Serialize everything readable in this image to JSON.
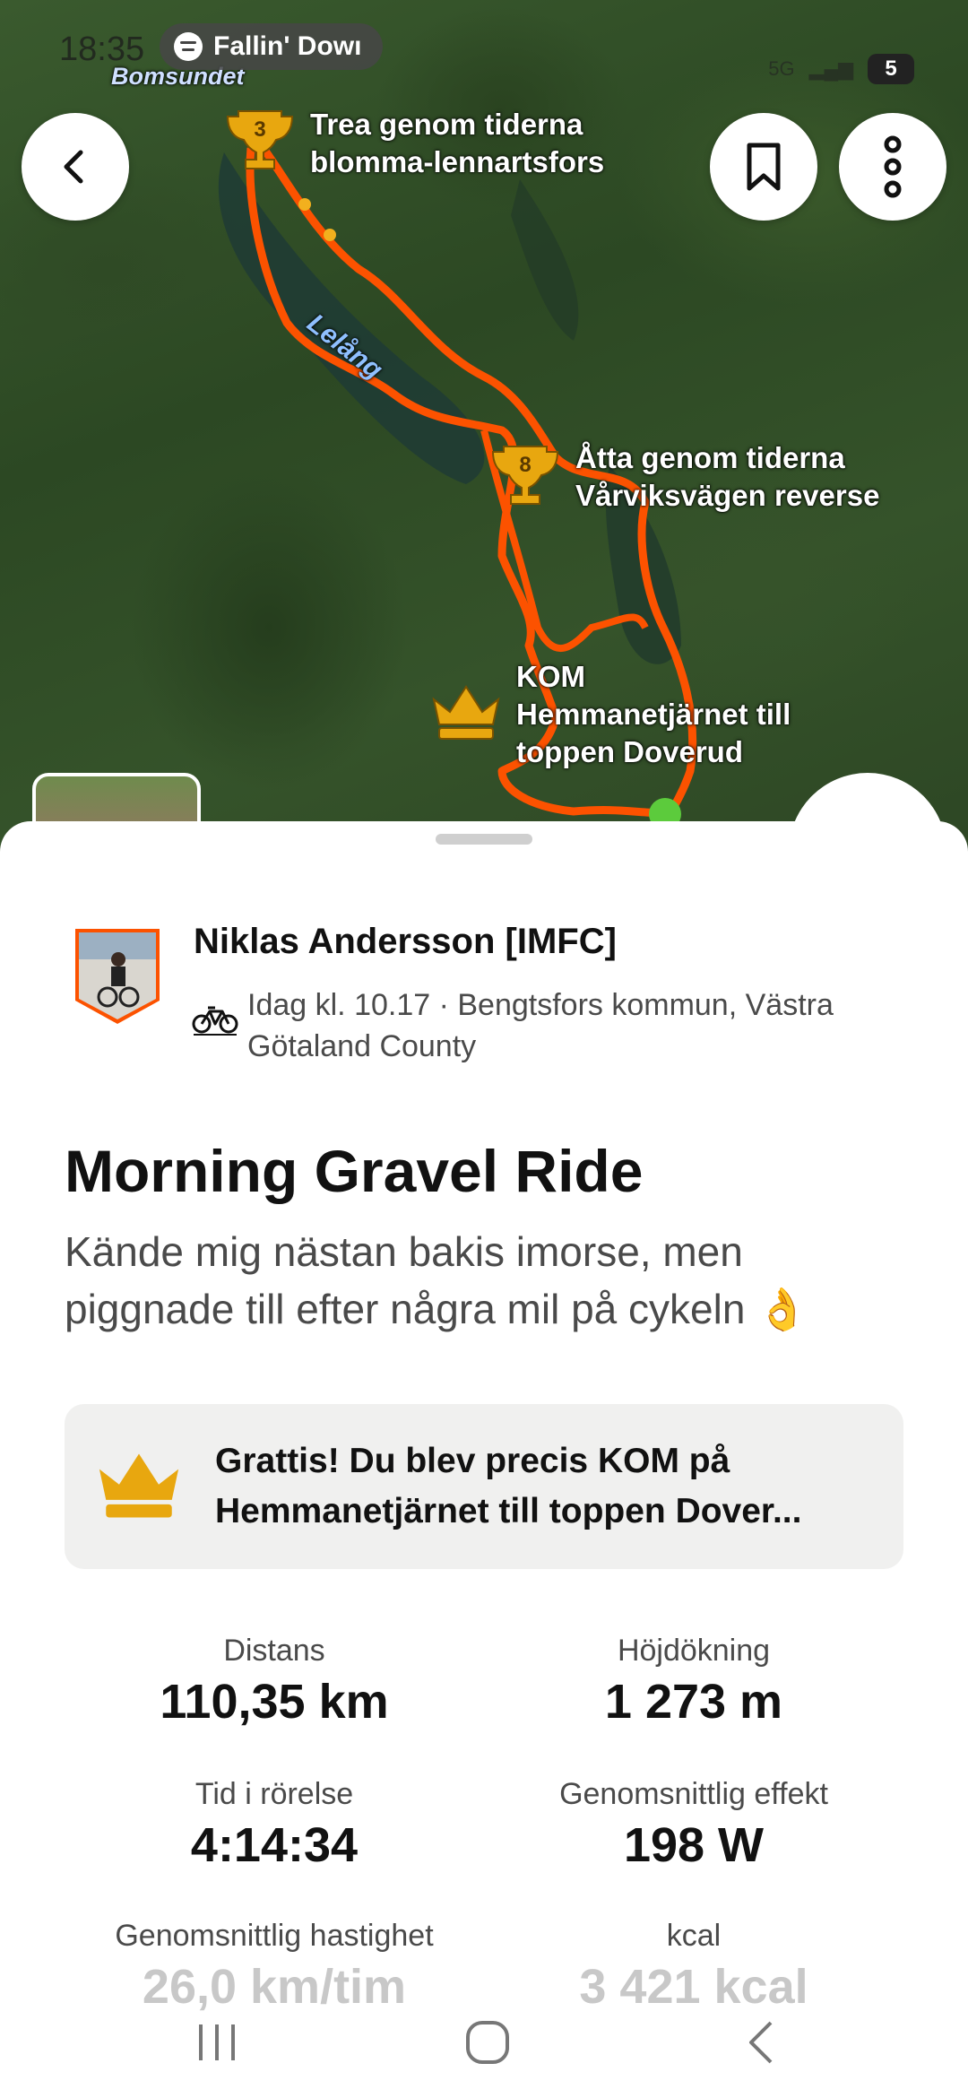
{
  "status": {
    "time": "18:35",
    "now_playing": "Fallin' Dowı",
    "network": "5G",
    "battery": "5"
  },
  "map": {
    "place_label": "Bomsundet",
    "lake_label": "Lelång",
    "segments": [
      {
        "rank": "3",
        "line1": "Trea genom tiderna",
        "line2": "blomma-lennartsfors"
      },
      {
        "rank": "8",
        "line1": "Åtta genom tiderna",
        "line2": "Vårviksvägen reverse"
      },
      {
        "rank": "KOM",
        "line1": "KOM",
        "line2": "Hemmanetjärnet till",
        "line3": "toppen Doverud"
      }
    ],
    "route_color": "#fc5200"
  },
  "activity": {
    "athlete": "Niklas Andersson [IMFC]",
    "meta": "Idag kl. 10.17 · Bengtsfors kommun, Västra Götaland County",
    "title": "Morning Gravel Ride",
    "description": "Kände mig nästan bakis imorse, men piggnade till efter några mil på cykeln 👌",
    "kom_message": "Grattis! Du blev precis KOM på Hemmanetjärnet till toppen Dover...",
    "stats": [
      {
        "label": "Distans",
        "value": "110,35 km"
      },
      {
        "label": "Höjdökning",
        "value": "1 273 m"
      },
      {
        "label": "Tid i rörelse",
        "value": "4:14:34"
      },
      {
        "label": "Genomsnittlig effekt",
        "value": "198 W"
      },
      {
        "label": "Genomsnittlig hastighet",
        "value": "26,0 km/tim"
      },
      {
        "label": "kcal",
        "value": "3 421 kcal"
      }
    ]
  },
  "colors": {
    "accent": "#fc5200",
    "crown": "#e8a70f"
  },
  "icons": [
    "back-icon",
    "bookmark-icon",
    "more-icon",
    "bike-icon",
    "crown-icon",
    "trophy-icon",
    "spotify-icon"
  ]
}
